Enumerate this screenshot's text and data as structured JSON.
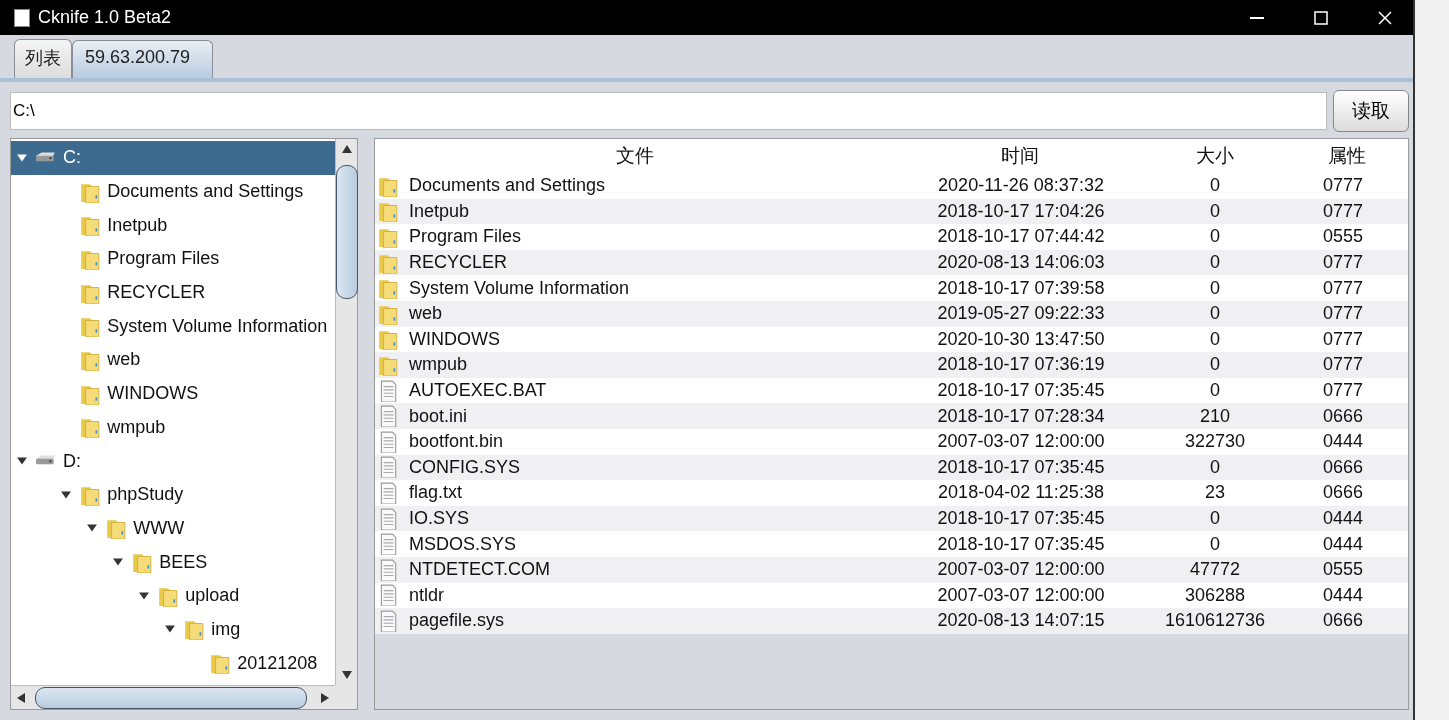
{
  "window": {
    "title": "Cknife 1.0 Beta2"
  },
  "tabs": [
    {
      "label": "列表",
      "selected": false
    },
    {
      "label": "59.63.200.79",
      "selected": true
    }
  ],
  "path_field": {
    "value": "C:\\"
  },
  "read_button": "读取",
  "tree": [
    {
      "label": "C:",
      "kind": "drive",
      "expanded": true,
      "selected": true,
      "children": [
        {
          "label": "Documents and Settings",
          "kind": "folder",
          "selected": false
        },
        {
          "label": "Inetpub",
          "kind": "folder",
          "selected": false
        },
        {
          "label": "Program Files",
          "kind": "folder",
          "selected": false
        },
        {
          "label": "RECYCLER",
          "kind": "folder",
          "selected": false
        },
        {
          "label": "System Volume Information",
          "kind": "folder",
          "selected": false
        },
        {
          "label": "web",
          "kind": "folder",
          "selected": false
        },
        {
          "label": "WINDOWS",
          "kind": "folder",
          "selected": false
        },
        {
          "label": "wmpub",
          "kind": "folder",
          "selected": false
        }
      ]
    },
    {
      "label": "D:",
      "kind": "drive",
      "expanded": true,
      "selected": false,
      "children": [
        {
          "label": "phpStudy",
          "kind": "folder",
          "expanded": true,
          "selected": false,
          "children": [
            {
              "label": "WWW",
              "kind": "folder",
              "expanded": true,
              "selected": false,
              "children": [
                {
                  "label": "BEES",
                  "kind": "folder",
                  "expanded": true,
                  "selected": false,
                  "children": [
                    {
                      "label": "upload",
                      "kind": "folder",
                      "expanded": true,
                      "selected": false,
                      "children": [
                        {
                          "label": "img",
                          "kind": "folder",
                          "expanded": true,
                          "selected": false,
                          "children": [
                            {
                              "label": "20121208",
                              "kind": "folder",
                              "selected": false
                            }
                          ]
                        }
                      ]
                    }
                  ]
                }
              ]
            }
          ]
        }
      ]
    }
  ],
  "table": {
    "columns": [
      "文件",
      "时间",
      "大小",
      "属性"
    ],
    "rows": [
      {
        "kind": "folder",
        "name": "Documents and Settings",
        "time": "2020-11-26 08:37:32",
        "size": "0",
        "attr": "0777"
      },
      {
        "kind": "folder",
        "name": "Inetpub",
        "time": "2018-10-17 17:04:26",
        "size": "0",
        "attr": "0777"
      },
      {
        "kind": "folder",
        "name": "Program Files",
        "time": "2018-10-17 07:44:42",
        "size": "0",
        "attr": "0555"
      },
      {
        "kind": "folder",
        "name": "RECYCLER",
        "time": "2020-08-13 14:06:03",
        "size": "0",
        "attr": "0777"
      },
      {
        "kind": "folder",
        "name": "System Volume Information",
        "time": "2018-10-17 07:39:58",
        "size": "0",
        "attr": "0777"
      },
      {
        "kind": "folder",
        "name": "web",
        "time": "2019-05-27 09:22:33",
        "size": "0",
        "attr": "0777"
      },
      {
        "kind": "folder",
        "name": "WINDOWS",
        "time": "2020-10-30 13:47:50",
        "size": "0",
        "attr": "0777"
      },
      {
        "kind": "folder",
        "name": "wmpub",
        "time": "2018-10-17 07:36:19",
        "size": "0",
        "attr": "0777"
      },
      {
        "kind": "file",
        "name": "AUTOEXEC.BAT",
        "time": "2018-10-17 07:35:45",
        "size": "0",
        "attr": "0777"
      },
      {
        "kind": "file",
        "name": "boot.ini",
        "time": "2018-10-17 07:28:34",
        "size": "210",
        "attr": "0666"
      },
      {
        "kind": "file",
        "name": "bootfont.bin",
        "time": "2007-03-07 12:00:00",
        "size": "322730",
        "attr": "0444"
      },
      {
        "kind": "file",
        "name": "CONFIG.SYS",
        "time": "2018-10-17 07:35:45",
        "size": "0",
        "attr": "0666"
      },
      {
        "kind": "file",
        "name": "flag.txt",
        "time": "2018-04-02 11:25:38",
        "size": "23",
        "attr": "0666"
      },
      {
        "kind": "file",
        "name": "IO.SYS",
        "time": "2018-10-17 07:35:45",
        "size": "0",
        "attr": "0444"
      },
      {
        "kind": "file",
        "name": "MSDOS.SYS",
        "time": "2018-10-17 07:35:45",
        "size": "0",
        "attr": "0444"
      },
      {
        "kind": "file",
        "name": "NTDETECT.COM",
        "time": "2007-03-07 12:00:00",
        "size": "47772",
        "attr": "0555"
      },
      {
        "kind": "file",
        "name": "ntldr",
        "time": "2007-03-07 12:00:00",
        "size": "306288",
        "attr": "0444"
      },
      {
        "kind": "file",
        "name": "pagefile.sys",
        "time": "2020-08-13 14:07:15",
        "size": "1610612736",
        "attr": "0666"
      }
    ]
  }
}
